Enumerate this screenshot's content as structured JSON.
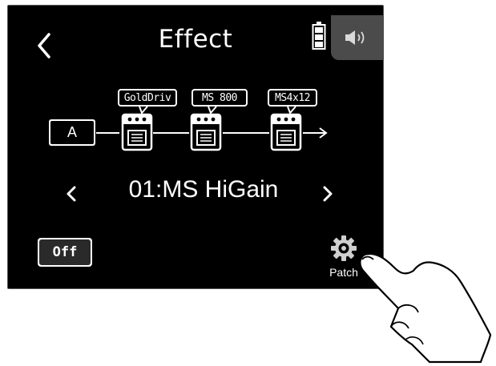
{
  "header": {
    "title": "Effect",
    "back_icon": "chevron-left-icon",
    "battery_icon": "battery-icon",
    "speaker_icon": "speaker-icon"
  },
  "chain": {
    "input_label": "A",
    "effects": [
      {
        "name": "GoldDriv",
        "icon": "pedal-icon"
      },
      {
        "name": "MS 800",
        "icon": "pedal-icon"
      },
      {
        "name": "MS4x12",
        "icon": "pedal-icon"
      }
    ]
  },
  "patch": {
    "name": "01:MS HiGain",
    "prev_icon": "chevron-left-icon",
    "next_icon": "chevron-right-icon"
  },
  "controls": {
    "off_label": "Off",
    "patch_label": "Patch",
    "patch_icon": "gear-icon"
  },
  "colors": {
    "screen_bg": "#000000",
    "text": "#ffffff",
    "speaker_tab": "#4b4b4b"
  }
}
